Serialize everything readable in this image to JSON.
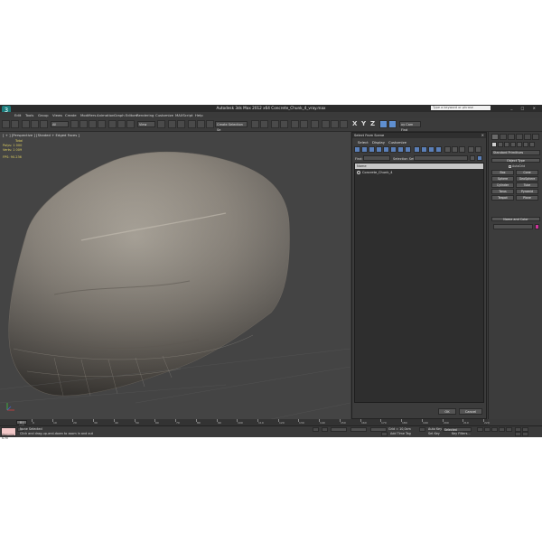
{
  "titlebar": {
    "logo": "3",
    "title": "Autodesk 3ds Max 2012 x64    Concrete_Chunk_4_vray.max",
    "help_placeholder": "Type a keyword or phrase",
    "window_controls": "_ □ ×"
  },
  "menu": [
    "Edit",
    "Tools",
    "Group",
    "Views",
    "Create",
    "Modifiers",
    "Animation",
    "Graph Editors",
    "Rendering",
    "Customize",
    "MAXScript",
    "Help"
  ],
  "toolbar": {
    "filter_label": "All",
    "view_label": "View",
    "selection_set_label": "Create Selection Se",
    "axis_tools": [
      "X",
      "Y",
      "Z"
    ],
    "right_label": "xy Cam Find"
  },
  "viewport": {
    "label": "[ + ] [Perspective ] [Shaded + Edged Faces ]",
    "stats_total_label": "Total",
    "polys_label": "Polys:",
    "polys_value": "1 000",
    "verts_label": "Verts:",
    "verts_value": "1 009",
    "fps_label": "FPS:",
    "fps_value": "90.236"
  },
  "select_dialog": {
    "title": "Select From Scene",
    "close": "×",
    "menu": [
      "Select",
      "Display",
      "Customize"
    ],
    "find_label": "Find:",
    "selection_set_label": "Selection Set:",
    "column_header": "Name",
    "objects": [
      "Concrete_Chunk_4"
    ],
    "ok_label": "OK",
    "cancel_label": "Cancel"
  },
  "command_panel": {
    "category": "Standard Primitives",
    "object_type_title": "Object Type",
    "autogrid_label": "AutoGrid",
    "primitives": [
      "Box",
      "Cone",
      "Sphere",
      "GeoSphere",
      "Cylinder",
      "Tube",
      "Torus",
      "Pyramid",
      "Teapot",
      "Plane"
    ],
    "name_color_title": "Name and Color",
    "color": "#cc3399"
  },
  "timeline": {
    "slider_label": "0 / 100",
    "ticks": [
      "0",
      "10",
      "20",
      "30",
      "40",
      "50",
      "60",
      "70",
      "80",
      "90",
      "100",
      "110",
      "120",
      "130",
      "140",
      "150",
      "160",
      "170",
      "180",
      "190",
      "200",
      "210",
      "220"
    ]
  },
  "statusbar": {
    "maxscript_label": "Welcome to M",
    "selection_status": "None Selected",
    "prompt": "Click and drag-up-and-down to zoom in and out",
    "grid_label": "Grid = 10,0cm",
    "add_time_tag": "Add Time Tag",
    "auto_key": "Auto Key",
    "selected": "Selected",
    "set_key": "Set Key",
    "key_filters": "Key Filters..."
  }
}
